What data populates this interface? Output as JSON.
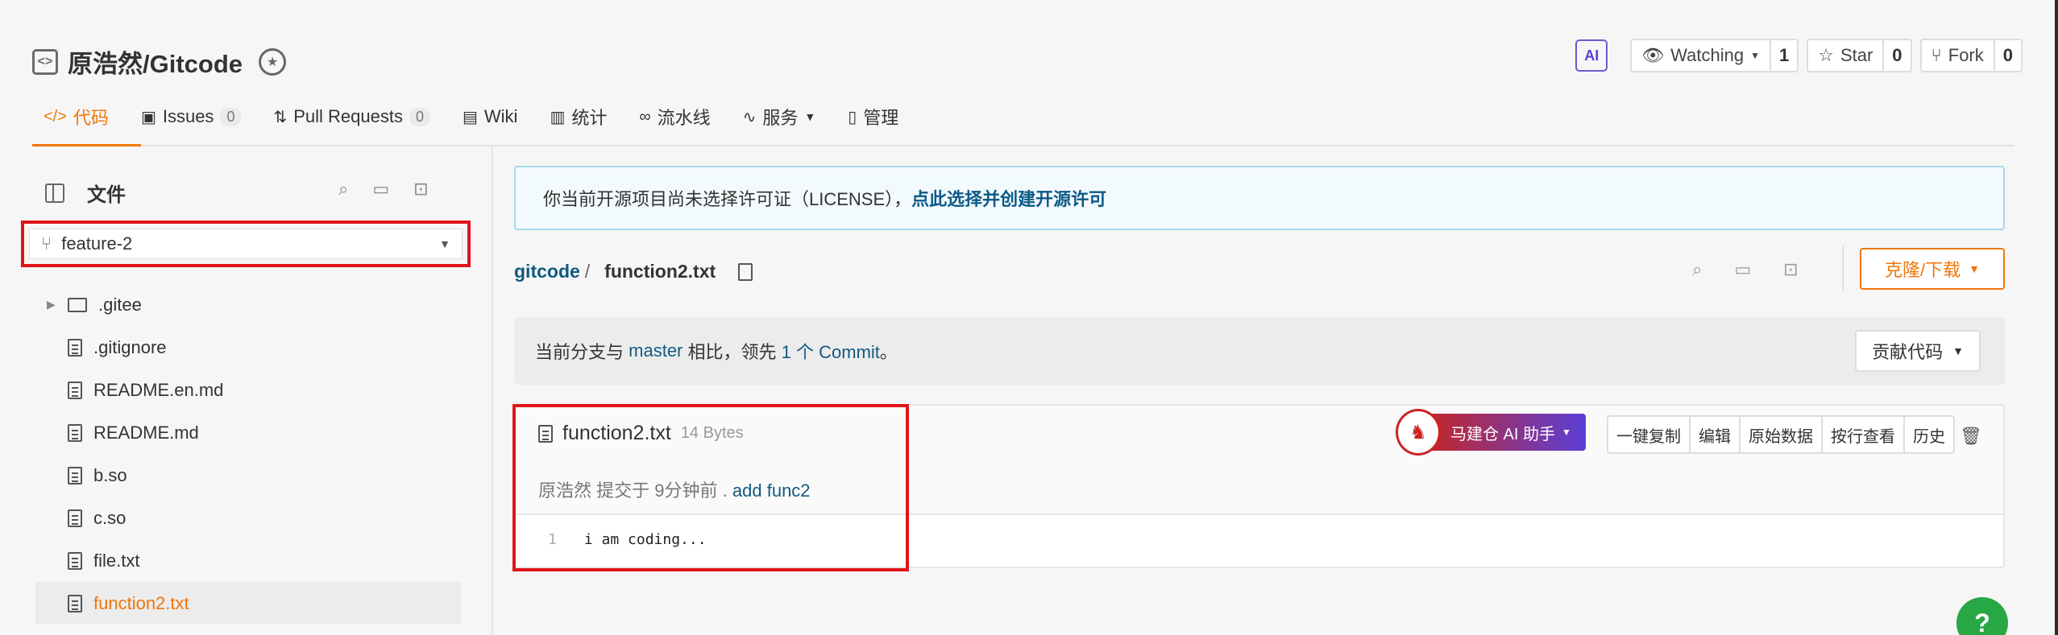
{
  "repo": {
    "title": "原浩然/Gitcode",
    "repo_icon": "code-brackets-icon",
    "badge_icon": "award-badge-icon"
  },
  "top_actions": {
    "ai_label": "AI",
    "watching_label": "Watching",
    "watching_count": "1",
    "star_label": "Star",
    "star_count": "0",
    "fork_label": "Fork",
    "fork_count": "0"
  },
  "tabs": [
    {
      "label": "代码",
      "icon": "code-icon",
      "active": true
    },
    {
      "label": "Issues",
      "count": "0",
      "icon": "issues-icon"
    },
    {
      "label": "Pull Requests",
      "count": "0",
      "icon": "pull-request-icon"
    },
    {
      "label": "Wiki",
      "icon": "book-icon"
    },
    {
      "label": "统计",
      "icon": "bar-chart-icon"
    },
    {
      "label": "流水线",
      "icon": "pipeline-icon"
    },
    {
      "label": "服务",
      "icon": "pulse-icon"
    },
    {
      "label": "管理",
      "icon": "document-icon"
    }
  ],
  "sidebar": {
    "title": "文件",
    "branch": "feature-2",
    "tree": [
      {
        "name": ".gitee",
        "type": "folder"
      },
      {
        "name": ".gitignore",
        "type": "file"
      },
      {
        "name": "README.en.md",
        "type": "file"
      },
      {
        "name": "README.md",
        "type": "file"
      },
      {
        "name": "b.so",
        "type": "file"
      },
      {
        "name": "c.so",
        "type": "file"
      },
      {
        "name": "file.txt",
        "type": "file"
      },
      {
        "name": "function2.txt",
        "type": "file",
        "active": true
      }
    ]
  },
  "license_notice": {
    "text": "你当前开源项目尚未选择许可证（LICENSE），",
    "link": "点此选择并创建开源许可"
  },
  "breadcrumb": {
    "root": "gitcode",
    "sep": "/",
    "file": "function2.txt"
  },
  "clone_button": "克隆/下载",
  "compare": {
    "prefix": "当前分支与",
    "base": "master",
    "middle": "相比，领先",
    "count": "1 个 Commit",
    "suffix": "。",
    "contribute": "贡献代码"
  },
  "file": {
    "name": "function2.txt",
    "size": "14 Bytes",
    "author": "原浩然",
    "commit_prefix": "提交于",
    "time": "9分钟前",
    "dot": ".",
    "message": "add func2",
    "lines": [
      {
        "no": "1",
        "text": "i am coding..."
      }
    ]
  },
  "ai_assistant": {
    "label": "马建仓 AI 助手"
  },
  "file_actions": [
    "一键复制",
    "编辑",
    "原始数据",
    "按行查看",
    "历史"
  ],
  "help": "?",
  "colors": {
    "accent": "#f0760a",
    "link": "#125a80",
    "highlight_box": "#e0141a",
    "help": "#28a745"
  }
}
